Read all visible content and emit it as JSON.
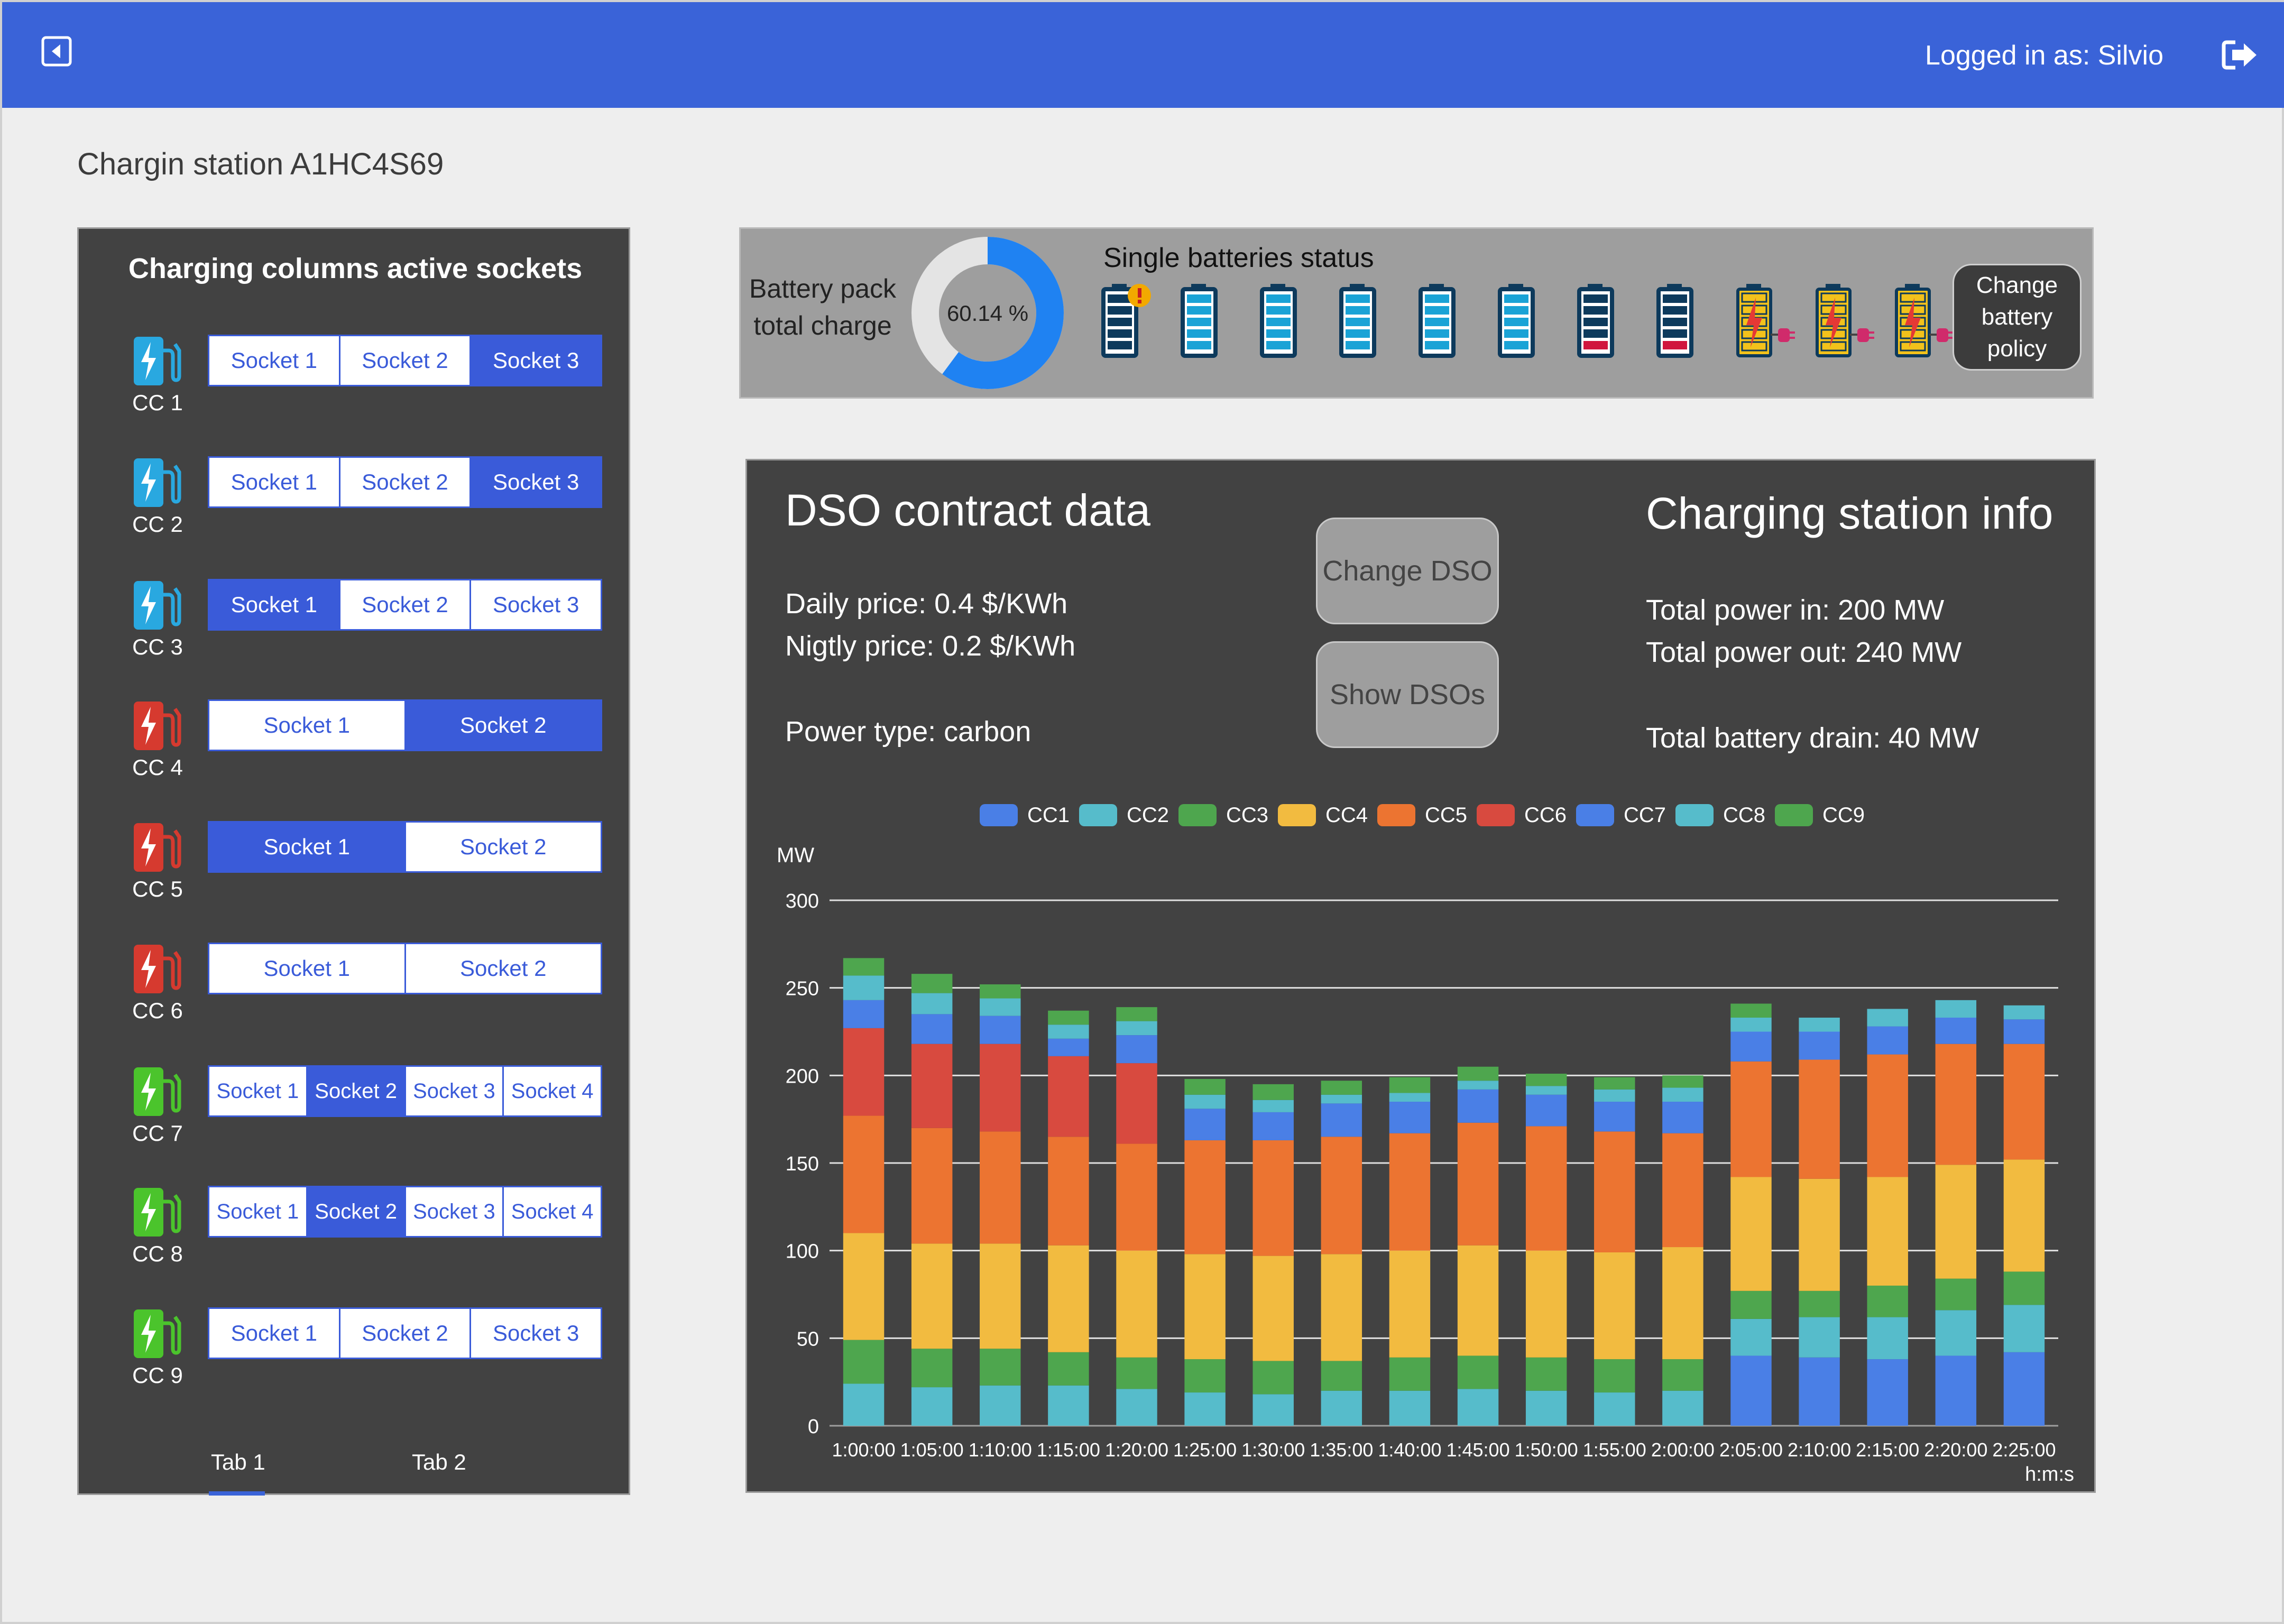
{
  "header": {
    "user_label": "Logged in as: Silvio",
    "back_icon": "back-icon",
    "logout_icon": "logout-icon"
  },
  "page": {
    "title": "Chargin station A1HC4S69"
  },
  "columns_panel": {
    "title": "Charging columns active sockets",
    "columns": [
      {
        "label": "CC 1",
        "status_color": "#29a8e0",
        "sockets": [
          "Socket 1",
          "Socket 2",
          "Socket 3"
        ],
        "active": [
          2
        ]
      },
      {
        "label": "CC 2",
        "status_color": "#29a8e0",
        "sockets": [
          "Socket 1",
          "Socket 2",
          "Socket 3"
        ],
        "active": [
          2
        ]
      },
      {
        "label": "CC 3",
        "status_color": "#29a8e0",
        "sockets": [
          "Socket 1",
          "Socket 2",
          "Socket 3"
        ],
        "active": [
          0
        ]
      },
      {
        "label": "CC 4",
        "status_color": "#d63a2f",
        "sockets": [
          "Socket 1",
          "Socket 2"
        ],
        "active": [
          1
        ]
      },
      {
        "label": "CC 5",
        "status_color": "#d63a2f",
        "sockets": [
          "Socket 1",
          "Socket 2"
        ],
        "active": [
          0
        ]
      },
      {
        "label": "CC 6",
        "status_color": "#d63a2f",
        "sockets": [
          "Socket 1",
          "Socket 2"
        ],
        "active": []
      },
      {
        "label": "CC 7",
        "status_color": "#4bc42c",
        "sockets": [
          "Socket 1",
          "Socket 2",
          "Socket 3",
          "Socket 4"
        ],
        "active": [
          1
        ]
      },
      {
        "label": "CC 8",
        "status_color": "#4bc42c",
        "sockets": [
          "Socket 1",
          "Socket 2",
          "Socket 3",
          "Socket 4"
        ],
        "active": [
          1
        ]
      },
      {
        "label": "CC 9",
        "status_color": "#4bc42c",
        "sockets": [
          "Socket 1",
          "Socket 2",
          "Socket 3"
        ],
        "active": []
      }
    ],
    "tabs": [
      "Tab 1",
      "Tab 2"
    ],
    "active_tab": 0
  },
  "battery": {
    "pack_label": "Battery pack total charge",
    "pack_label_line1": "Battery pack",
    "pack_label_line2": "total charge",
    "charge_percent": 60.14,
    "charge_text": "60.14 %",
    "single_title": "Single batteries status",
    "cells": [
      {
        "state": "warning"
      },
      {
        "state": "full"
      },
      {
        "state": "full"
      },
      {
        "state": "full"
      },
      {
        "state": "full"
      },
      {
        "state": "full"
      },
      {
        "state": "low"
      },
      {
        "state": "low"
      },
      {
        "state": "charging"
      },
      {
        "state": "charging"
      },
      {
        "state": "charging"
      }
    ],
    "policy_button": "Change battery policy",
    "policy_line1": "Change",
    "policy_line2": "battery",
    "policy_line3": "policy"
  },
  "dso": {
    "title": "DSO contract data",
    "daily_price": "Daily price: 0.4 $/KWh",
    "nightly_price": "Nigtly price: 0.2 $/KWh",
    "power_type": "Power type: carbon",
    "change_button": "Change DSO",
    "show_button": "Show DSOs"
  },
  "station_info": {
    "title": "Charging station info",
    "power_in": "Total power in: 200 MW",
    "power_out": "Total power out: 240 MW",
    "battery_drain": "Total battery drain: 40 MW"
  },
  "chart_data": {
    "type": "bar",
    "stacked": true,
    "ylabel": "MW",
    "xlabel": "h:m:s",
    "ylim": [
      0,
      300
    ],
    "yticks": [
      0,
      50,
      100,
      150,
      200,
      250,
      300
    ],
    "grid": true,
    "legend_position": "top",
    "categories": [
      "1:00:00",
      "1:05:00",
      "1:10:00",
      "1:15:00",
      "1:20:00",
      "1:25:00",
      "1:30:00",
      "1:35:00",
      "1:40:00",
      "1:45:00",
      "1:50:00",
      "1:55:00",
      "2:00:00",
      "2:05:00",
      "2:10:00",
      "2:15:00",
      "2:20:00",
      "2:25:00"
    ],
    "series": [
      {
        "name": "CC1",
        "color": "#4a7fe6",
        "values": [
          0,
          0,
          0,
          0,
          0,
          0,
          0,
          0,
          0,
          0,
          0,
          0,
          0,
          40,
          39,
          38,
          40,
          42
        ]
      },
      {
        "name": "CC2",
        "color": "#56bccb",
        "values": [
          24,
          22,
          23,
          23,
          21,
          19,
          18,
          20,
          20,
          21,
          20,
          19,
          20,
          21,
          23,
          24,
          26,
          27
        ]
      },
      {
        "name": "CC3",
        "color": "#4ea64e",
        "values": [
          25,
          22,
          21,
          19,
          18,
          19,
          19,
          17,
          19,
          19,
          19,
          19,
          18,
          16,
          15,
          18,
          18,
          19
        ]
      },
      {
        "name": "CC4",
        "color": "#f2bb40",
        "values": [
          61,
          60,
          60,
          61,
          61,
          60,
          60,
          61,
          61,
          63,
          61,
          61,
          64,
          65,
          64,
          62,
          65,
          64
        ]
      },
      {
        "name": "CC5",
        "color": "#ec7431",
        "values": [
          67,
          66,
          64,
          62,
          61,
          65,
          66,
          67,
          67,
          70,
          71,
          69,
          65,
          66,
          68,
          70,
          69,
          66
        ]
      },
      {
        "name": "CC6",
        "color": "#d84a3f",
        "values": [
          50,
          48,
          50,
          46,
          46,
          0,
          0,
          0,
          0,
          0,
          0,
          0,
          0,
          0,
          0,
          0,
          0,
          0
        ]
      },
      {
        "name": "CC7",
        "color": "#4a7fe6",
        "values": [
          16,
          17,
          16,
          10,
          16,
          18,
          16,
          19,
          18,
          19,
          18,
          17,
          18,
          17,
          16,
          16,
          15,
          14
        ]
      },
      {
        "name": "CC8",
        "color": "#56bccb",
        "values": [
          14,
          12,
          10,
          8,
          8,
          8,
          7,
          5,
          5,
          5,
          5,
          7,
          8,
          8,
          8,
          10,
          10,
          8
        ]
      },
      {
        "name": "CC9",
        "color": "#4ea64e",
        "values": [
          10,
          11,
          8,
          8,
          8,
          9,
          9,
          8,
          9,
          8,
          7,
          7,
          7,
          8,
          0,
          0,
          0,
          0
        ]
      }
    ]
  }
}
